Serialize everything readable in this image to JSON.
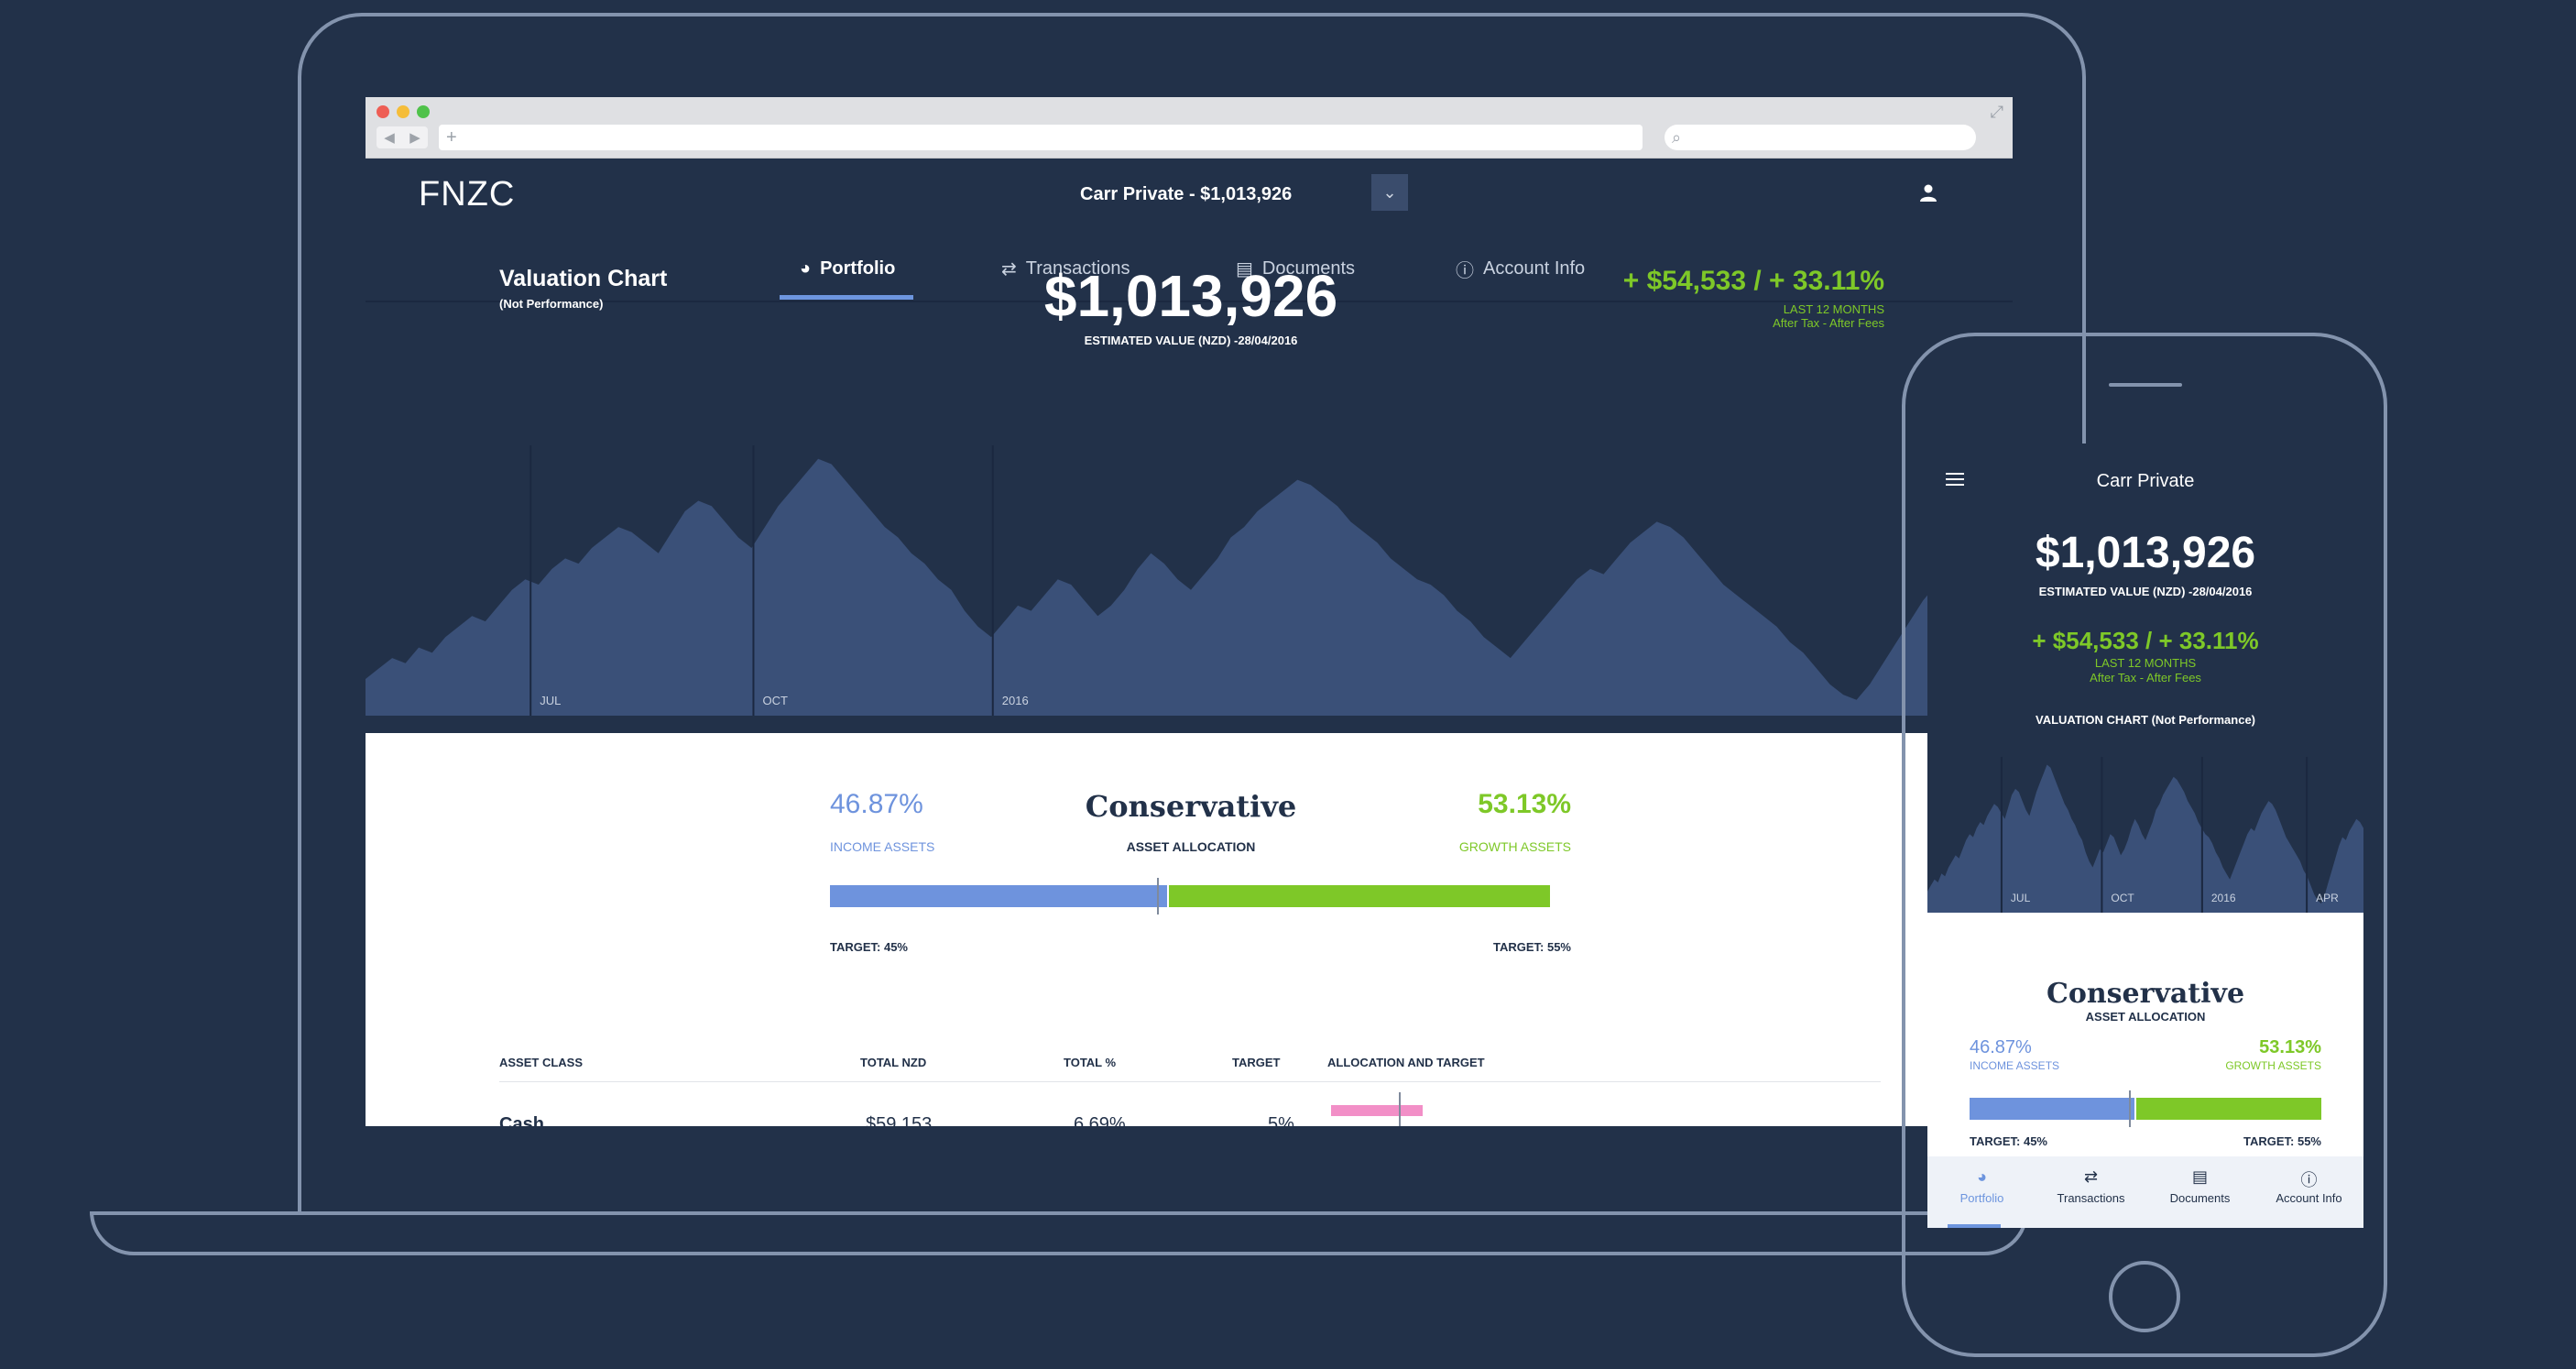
{
  "browser": {
    "nav_back": "◀",
    "nav_forward": "▶",
    "new_tab": "+",
    "search_glyph": "⌕",
    "expand_glyph": "⤢"
  },
  "app": {
    "logo": "FNZC",
    "account_selector": "Carr Private - $1,013,926",
    "dropdown_glyph": "⌄",
    "tabs": [
      {
        "label": "Portfolio",
        "icon": "pie-chart-icon",
        "active": true
      },
      {
        "label": "Transactions",
        "icon": "swap-arrows-icon",
        "active": false
      },
      {
        "label": "Documents",
        "icon": "documents-icon",
        "active": false
      },
      {
        "label": "Account Info",
        "icon": "info-icon",
        "active": false
      }
    ],
    "tab_glyphs": [
      "◕",
      "⇄",
      "▤",
      "ⓘ"
    ]
  },
  "valuation": {
    "title": "Valuation Chart",
    "subtitle": "(Not Performance)",
    "value": "$1,013,926",
    "estimated_label": "ESTIMATED VALUE (NZD) -28/04/2016",
    "change": "+ $54,533 / + 33.11%",
    "period": "LAST 12 MONTHS",
    "tax_note": "After Tax - After Fees"
  },
  "chart_data": {
    "type": "area",
    "x_ticks": [
      "JUL",
      "OCT",
      "2016"
    ],
    "values": [
      14,
      18,
      22,
      20,
      26,
      24,
      30,
      34,
      38,
      36,
      42,
      48,
      52,
      50,
      56,
      60,
      58,
      64,
      68,
      72,
      70,
      66,
      62,
      70,
      78,
      82,
      80,
      74,
      68,
      64,
      72,
      80,
      86,
      92,
      98,
      96,
      90,
      84,
      78,
      72,
      68,
      62,
      58,
      52,
      48,
      40,
      34,
      30,
      36,
      42,
      40,
      46,
      52,
      50,
      44,
      38,
      42,
      48,
      56,
      62,
      58,
      52,
      48,
      54,
      60,
      68,
      72,
      78,
      82,
      86,
      90,
      88,
      84,
      80,
      74,
      70,
      66,
      60,
      56,
      52,
      50,
      46,
      40,
      36,
      30,
      26,
      22,
      28,
      34,
      40,
      46,
      52,
      56,
      54,
      60,
      66,
      70,
      74,
      72,
      68,
      62,
      56,
      50,
      46,
      42,
      38,
      34,
      28,
      24,
      18,
      12,
      8,
      6,
      12,
      20,
      28,
      36,
      44,
      50,
      48,
      54,
      58,
      62,
      60,
      56
    ],
    "colors": {
      "area": "#3a5078",
      "bg": "#223149"
    }
  },
  "allocation": {
    "income_pct": "46.87%",
    "income_label": "INCOME ASSETS",
    "title": "Conservative",
    "subtitle": "ASSET ALLOCATION",
    "growth_pct": "53.13%",
    "growth_label": "GROWTH ASSETS",
    "income_share": 0.4687,
    "target_income": "TARGET: 45%",
    "target_growth": "TARGET: 55%",
    "income_color": "#6e93dd",
    "growth_color": "#7ec828"
  },
  "table": {
    "headers": [
      "ASSET CLASS",
      "TOTAL NZD",
      "TOTAL %",
      "TARGET",
      "ALLOCATION AND TARGET"
    ],
    "rows": [
      {
        "asset_class": "Cash",
        "total_nzd": "$59,153",
        "total_pct": "6.69%",
        "target": "5%"
      }
    ],
    "cash_bar_color": "#f28fc7"
  },
  "phone": {
    "title": "Carr Private",
    "value": "$1,013,926",
    "estimated_label": "ESTIMATED VALUE (NZD) -28/04/2016",
    "change": "+ $54,533 / + 33.11%",
    "period": "LAST 12 MONTHS",
    "tax_note": "After Tax - After Fees",
    "chart_label": "VALUATION CHART (Not Performance)",
    "x_ticks": [
      "JUL",
      "OCT",
      "2016",
      "APR"
    ],
    "allocation_title": "Conservative",
    "allocation_sub": "ASSET ALLOCATION",
    "income_pct": "46.87%",
    "income_label": "INCOME ASSETS",
    "growth_pct": "53.13%",
    "growth_label": "GROWTH ASSETS",
    "target_income": "TARGET: 45%",
    "target_growth": "TARGET: 55%",
    "nav": [
      {
        "label": "Portfolio",
        "icon": "pie-chart-icon",
        "glyph": "◕",
        "active": true
      },
      {
        "label": "Transactions",
        "icon": "swap-arrows-icon",
        "glyph": "⇄",
        "active": false
      },
      {
        "label": "Documents",
        "icon": "documents-icon",
        "glyph": "▤",
        "active": false
      },
      {
        "label": "Account Info",
        "icon": "info-icon",
        "glyph": "ⓘ",
        "active": false
      }
    ]
  }
}
